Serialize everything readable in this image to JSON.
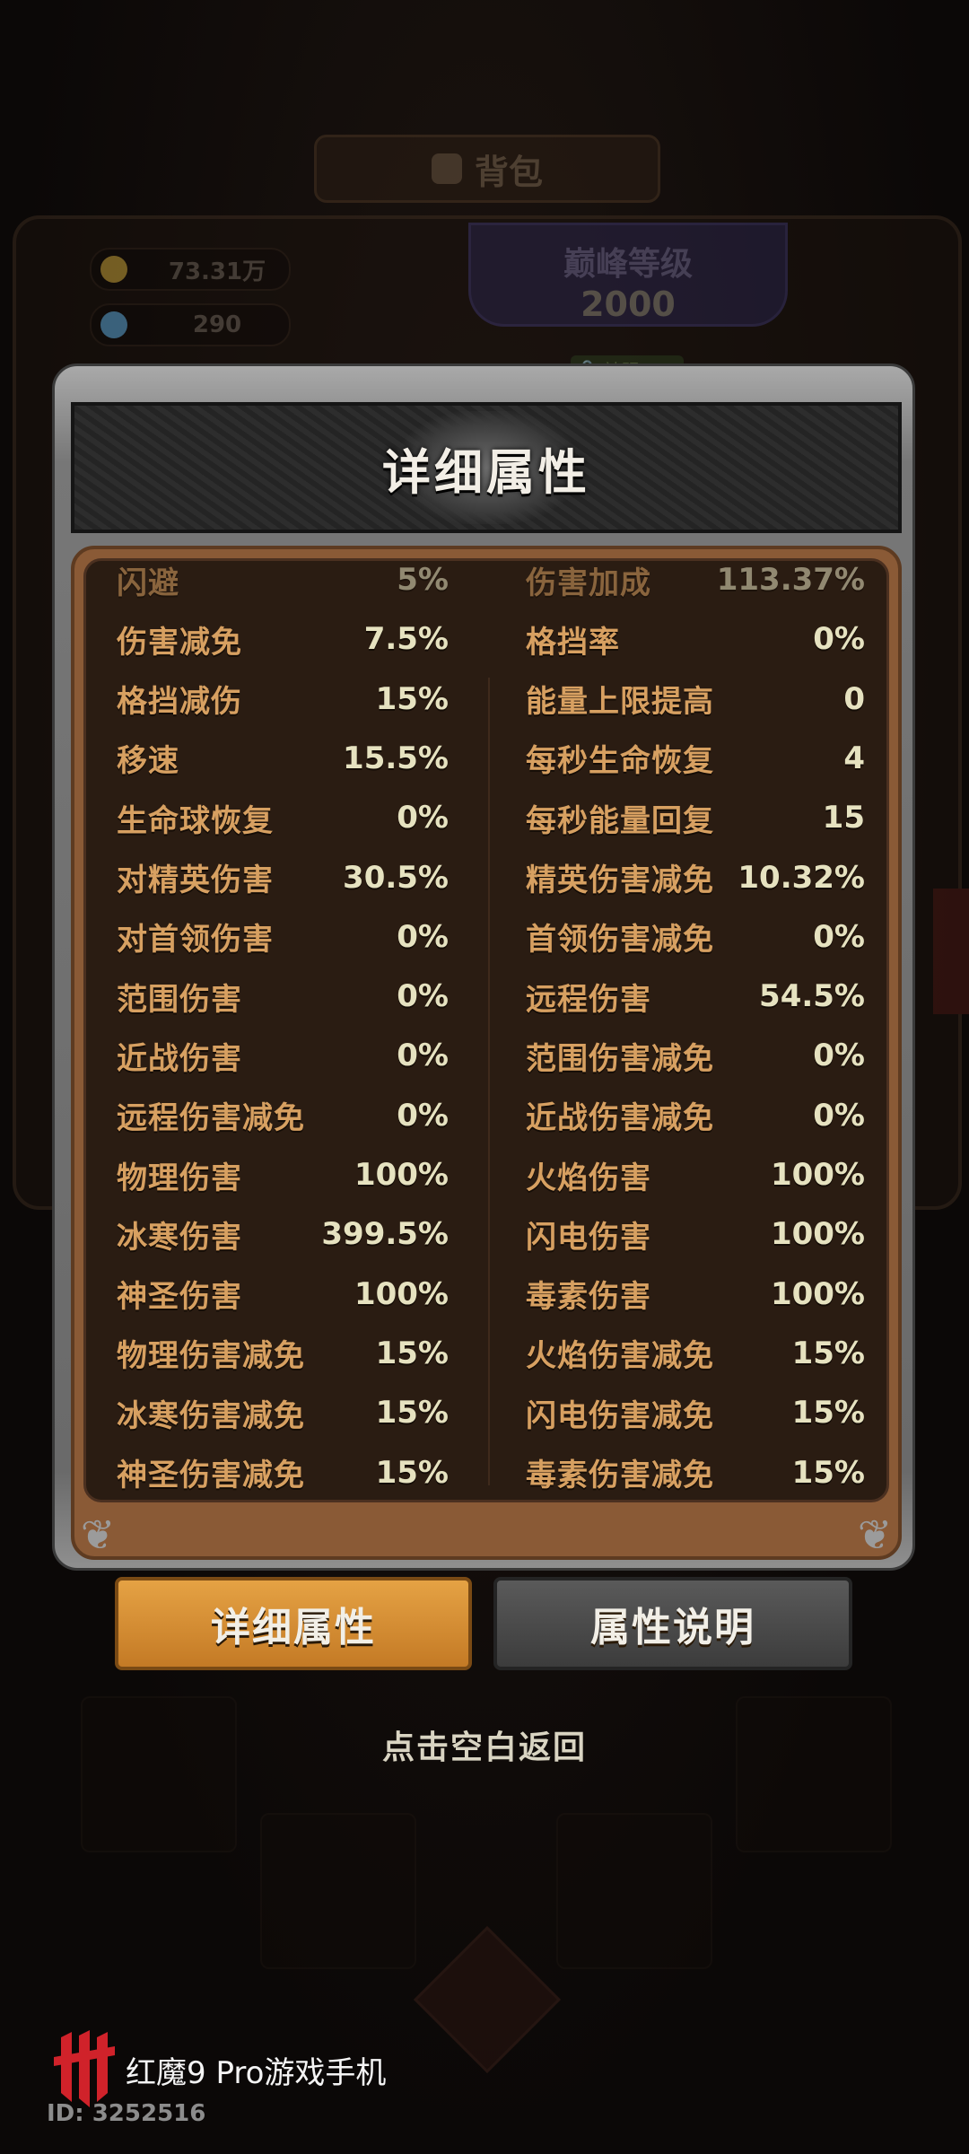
{
  "background": {
    "bag_tab_label": "背包",
    "currencies": [
      {
        "name": "gold",
        "value": "73.31万",
        "icon": "gold-coin-icon",
        "color": "#c9a23a"
      },
      {
        "name": "gem",
        "value": "290",
        "icon": "diamond-icon",
        "color": "#5fa8d8"
      }
    ],
    "peak_level": {
      "title": "巅峰等级",
      "value": "2000"
    },
    "lock_tag": "神赐"
  },
  "modal": {
    "title": "详细属性",
    "rows": [
      {
        "left_label": "闪避",
        "left_value": "5%",
        "right_label": "伤害加成",
        "right_value": "113.37%"
      },
      {
        "left_label": "伤害减免",
        "left_value": "7.5%",
        "right_label": "格挡率",
        "right_value": "0%"
      },
      {
        "left_label": "格挡减伤",
        "left_value": "15%",
        "right_label": "能量上限提高",
        "right_value": "0"
      },
      {
        "left_label": "移速",
        "left_value": "15.5%",
        "right_label": "每秒生命恢复",
        "right_value": "4"
      },
      {
        "left_label": "生命球恢复",
        "left_value": "0%",
        "right_label": "每秒能量回复",
        "right_value": "15"
      },
      {
        "left_label": "对精英伤害",
        "left_value": "30.5%",
        "right_label": "精英伤害减免",
        "right_value": "10.32%"
      },
      {
        "left_label": "对首领伤害",
        "left_value": "0%",
        "right_label": "首领伤害减免",
        "right_value": "0%"
      },
      {
        "left_label": "范围伤害",
        "left_value": "0%",
        "right_label": "远程伤害",
        "right_value": "54.5%"
      },
      {
        "left_label": "近战伤害",
        "left_value": "0%",
        "right_label": "范围伤害减免",
        "right_value": "0%"
      },
      {
        "left_label": "远程伤害减免",
        "left_value": "0%",
        "right_label": "近战伤害减免",
        "right_value": "0%"
      },
      {
        "left_label": "物理伤害",
        "left_value": "100%",
        "right_label": "火焰伤害",
        "right_value": "100%"
      },
      {
        "left_label": "冰寒伤害",
        "left_value": "399.5%",
        "right_label": "闪电伤害",
        "right_value": "100%"
      },
      {
        "left_label": "神圣伤害",
        "left_value": "100%",
        "right_label": "毒素伤害",
        "right_value": "100%"
      },
      {
        "left_label": "物理伤害减免",
        "left_value": "15%",
        "right_label": "火焰伤害减免",
        "right_value": "15%"
      },
      {
        "left_label": "冰寒伤害减免",
        "left_value": "15%",
        "right_label": "闪电伤害减免",
        "right_value": "15%"
      },
      {
        "left_label": "神圣伤害减免",
        "left_value": "15%",
        "right_label": "毒素伤害减免",
        "right_value": "15%"
      }
    ]
  },
  "tabs": {
    "detail_label": "详细属性",
    "explain_label": "属性说明"
  },
  "hint": "点击空白返回",
  "watermark": {
    "brand": "红魔9 Pro游戏手机",
    "id": "ID: 3252516"
  },
  "colors": {
    "label": "#d7a061",
    "value": "#e6e2c0",
    "active_tab": "#d88d30",
    "inactive_tab": "#4a4a4a",
    "panel_bg": "#2a1c12"
  }
}
